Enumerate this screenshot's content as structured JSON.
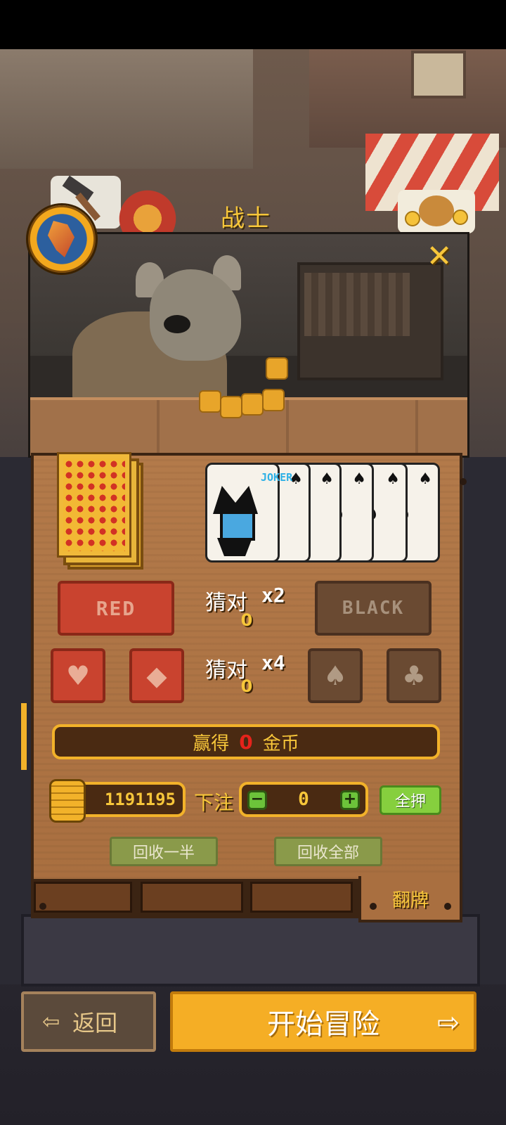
{
  "header": {
    "class_name": "战士"
  },
  "colors": {
    "gold": "#f7c63a",
    "red_button": "#c9432f",
    "dark_button": "#6a4a32",
    "win_amount": "#e5231b",
    "start_button": "#f5ae25",
    "green_button": "#86cf3e"
  },
  "icons": {
    "close": "close-icon",
    "hammer": "hammer-icon",
    "money_bag": "money-bag-icon",
    "class_emblem": "warrior-emblem-icon",
    "heart": "heart-icon",
    "diamond": "diamond-icon",
    "spade": "spade-icon",
    "club": "club-icon",
    "back": "back-icon",
    "exit": "exit-icon"
  },
  "cards": {
    "joker_text": "JOKER",
    "card_suit_glyph": "♠",
    "glyphs": {
      "close": "✕",
      "heart": "♥",
      "diamond": "◆",
      "spade": "♠",
      "club": "♣",
      "minus": "−",
      "plus": "+",
      "back": "⇦",
      "exit": "⇨"
    }
  },
  "color_guess": {
    "red_label": "RED",
    "black_label": "BLACK",
    "guess_label": "猜对",
    "multiplier": "x2",
    "current_value": "0"
  },
  "suit_guess": {
    "guess_label": "猜对",
    "multiplier": "x4",
    "current_value": "0"
  },
  "win": {
    "prefix": "赢得",
    "amount": "0",
    "suffix": "金币"
  },
  "wallet": {
    "coins": "1191195"
  },
  "bet": {
    "label": "下注",
    "value": "0",
    "all_in_label": "全押"
  },
  "recover": {
    "half_label": "回收一半",
    "all_label": "回收全部"
  },
  "draw": {
    "label": "翻牌"
  },
  "footer": {
    "back_label": "返回",
    "start_label": "开始冒险"
  }
}
